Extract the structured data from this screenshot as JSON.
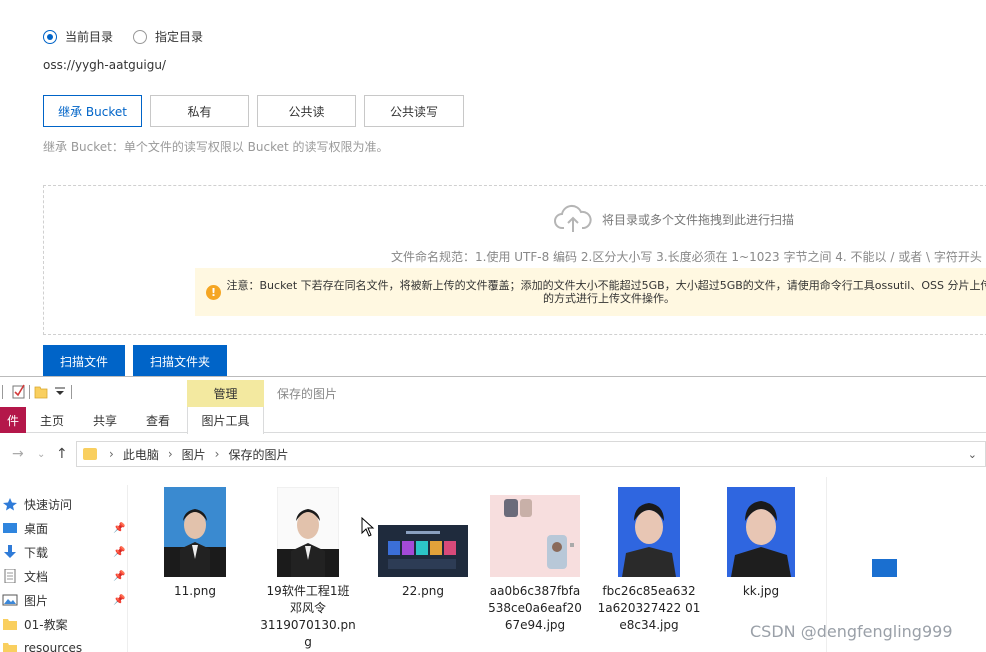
{
  "oss": {
    "radio_current": "当前目录",
    "radio_specified": "指定目录",
    "path": "oss://yygh-aatguigu/",
    "acl_buttons": [
      "继承 Bucket",
      "私有",
      "公共读",
      "公共读写"
    ],
    "acl_hint": "继承 Bucket：单个文件的读写权限以 Bucket 的读写权限为准。",
    "drop_text": "将目录或多个文件拖拽到此进行扫描",
    "naming_rule": "文件命名规范：1.使用 UTF-8 编码 2.区分大小写 3.长度必须在 1~1023 字节之间 4. 不能以 / 或者 \\ 字符开头",
    "warning": "注意：Bucket 下若存在同名文件，将被新上传的文件覆盖；添加的文件大小不能超过5GB，大小超过5GB的文件，请使用命令行工具ossutil、OSS 分片上传的方式进行上传文件操作。",
    "scan_file": "扫描文件",
    "scan_folder": "扫描文件夹",
    "accent_color": "#0064c8"
  },
  "explorer": {
    "context_tab": "管理",
    "window_title": "保存的图片",
    "tabs": {
      "file": "件",
      "home": "主页",
      "share": "共享",
      "view": "查看",
      "picture_tools": "图片工具"
    },
    "breadcrumb": [
      "此电脑",
      "图片",
      "保存的图片"
    ],
    "nav": [
      {
        "label": "快速访问",
        "icon": "star-icon"
      },
      {
        "label": "桌面",
        "icon": "desktop-icon"
      },
      {
        "label": "下载",
        "icon": "download-icon"
      },
      {
        "label": "文档",
        "icon": "document-icon"
      },
      {
        "label": "图片",
        "icon": "picture-icon"
      },
      {
        "label": "01-教案",
        "icon": "folder-icon"
      },
      {
        "label": "resources",
        "icon": "folder-icon"
      }
    ],
    "files": [
      {
        "name": "11.png"
      },
      {
        "name": "19软件工程1班\n邓风令\n3119070130.pn\ng"
      },
      {
        "name": "22.png"
      },
      {
        "name": "aa0b6c387fbfa\n538ce0a6eaf20\n67e94.jpg"
      },
      {
        "name": "fbc26c85ea632\n1a620327422 01\ne8c34.jpg"
      },
      {
        "name": "kk.jpg"
      }
    ]
  },
  "watermark": "CSDN @dengfengling999"
}
